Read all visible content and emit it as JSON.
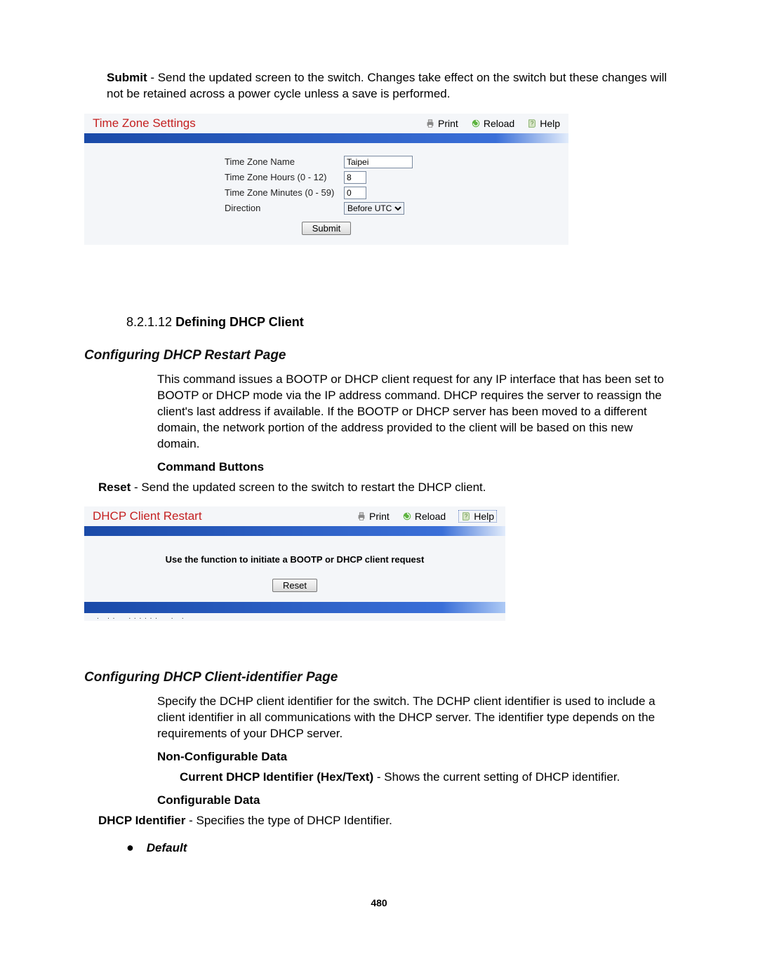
{
  "intro": {
    "submit_label": "Submit",
    "submit_text": " - Send the updated screen to the switch. Changes take effect on the switch but these changes will not be retained across a power cycle unless a save is performed."
  },
  "panel1": {
    "title": "Time Zone Settings",
    "actions": {
      "print": "Print",
      "reload": "Reload",
      "help": "Help"
    },
    "rows": {
      "tz_name_label": "Time Zone Name",
      "tz_name_value": "Taipei",
      "tz_hours_label": "Time Zone Hours (0 - 12)",
      "tz_hours_value": "8",
      "tz_minutes_label": "Time Zone Minutes (0 - 59)",
      "tz_minutes_value": "0",
      "direction_label": "Direction",
      "direction_value": "Before UTC"
    },
    "submit_btn": "Submit"
  },
  "section": {
    "number": "8.2.1.12 ",
    "title": "Defining DHCP Client"
  },
  "restart": {
    "heading": "Configuring DHCP Restart Page",
    "para": "This command issues a BOOTP or DHCP client request for any IP interface that has been set to BOOTP or DHCP mode via the IP address command. DHCP requires the server to reassign the client's last address if available. If the BOOTP or DHCP server has been moved to a different domain, the network portion of the address provided to the client will be based on this new domain.",
    "cmd_heading": "Command Buttons",
    "reset_label": "Reset",
    "reset_text": " - Send the updated screen to the switch to restart the DHCP client."
  },
  "panel2": {
    "title": "DHCP Client Restart",
    "actions": {
      "print": "Print",
      "reload": "Reload",
      "help": "Help"
    },
    "note": "Use the function to initiate a BOOTP or DHCP client request",
    "reset_btn": "Reset"
  },
  "ident": {
    "heading": "Configuring DHCP Client-identifier Page",
    "para": "Specify the DCHP client identifier for the switch. The DCHP client identifier is used to include a client identifier in all communications with the DHCP server. The identifier type depends on the requirements of your DHCP server.",
    "noncfg_heading": "Non-Configurable Data",
    "current_label": "Current DHCP Identifier (Hex/Text)",
    "current_text": " - Shows the current setting of DHCP identifier.",
    "cfg_heading": "Configurable Data",
    "dhcp_id_label": "DHCP Identifier",
    "dhcp_id_text": " - Specifies the type of DHCP Identifier.",
    "bullet_default": "Default"
  },
  "page_number": "480"
}
